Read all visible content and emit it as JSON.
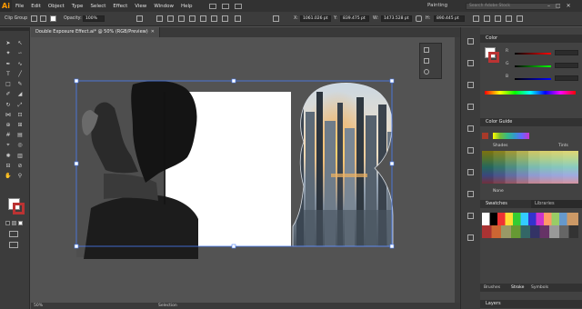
{
  "app": {
    "logo": "Ai"
  },
  "menu": [
    "File",
    "Edit",
    "Object",
    "Type",
    "Select",
    "Effect",
    "View",
    "Window",
    "Help"
  ],
  "workspace": "Painting",
  "search_placeholder": "Search Adobe Stock",
  "control_bar": {
    "selection_label": "Clip Group",
    "opacity_label": "Opacity:",
    "opacity_value": "100%",
    "x_label": "X:",
    "x_value": "1061.026 pt",
    "y_label": "Y:",
    "y_value": "839.475 pt",
    "w_label": "W:",
    "w_value": "1473.528 pt",
    "h_label": "H:",
    "h_value": "890.445 pt"
  },
  "document": {
    "tab_title": "Double Exposure Effect.ai* @ 50% (RGB/Preview)",
    "zoom": "50%",
    "status": "Selection"
  },
  "panels": {
    "color": {
      "title": "Color",
      "r": "R",
      "g": "G",
      "b": "B"
    },
    "color_guide": {
      "title": "Color Guide",
      "shades": "Shades",
      "tints": "Tints",
      "none": "None"
    },
    "swatches": {
      "tab1": "Swatches",
      "tab2": "Libraries"
    },
    "bottom_tabs": [
      "Brushes",
      "Stroke",
      "Symbols"
    ],
    "layers": "Layers"
  },
  "colors": {
    "menubar": "#323232",
    "panel": "#3c3c3c",
    "artboard": "#ffffff",
    "selection": "#4a7df7",
    "logo": "#ff9a00"
  }
}
